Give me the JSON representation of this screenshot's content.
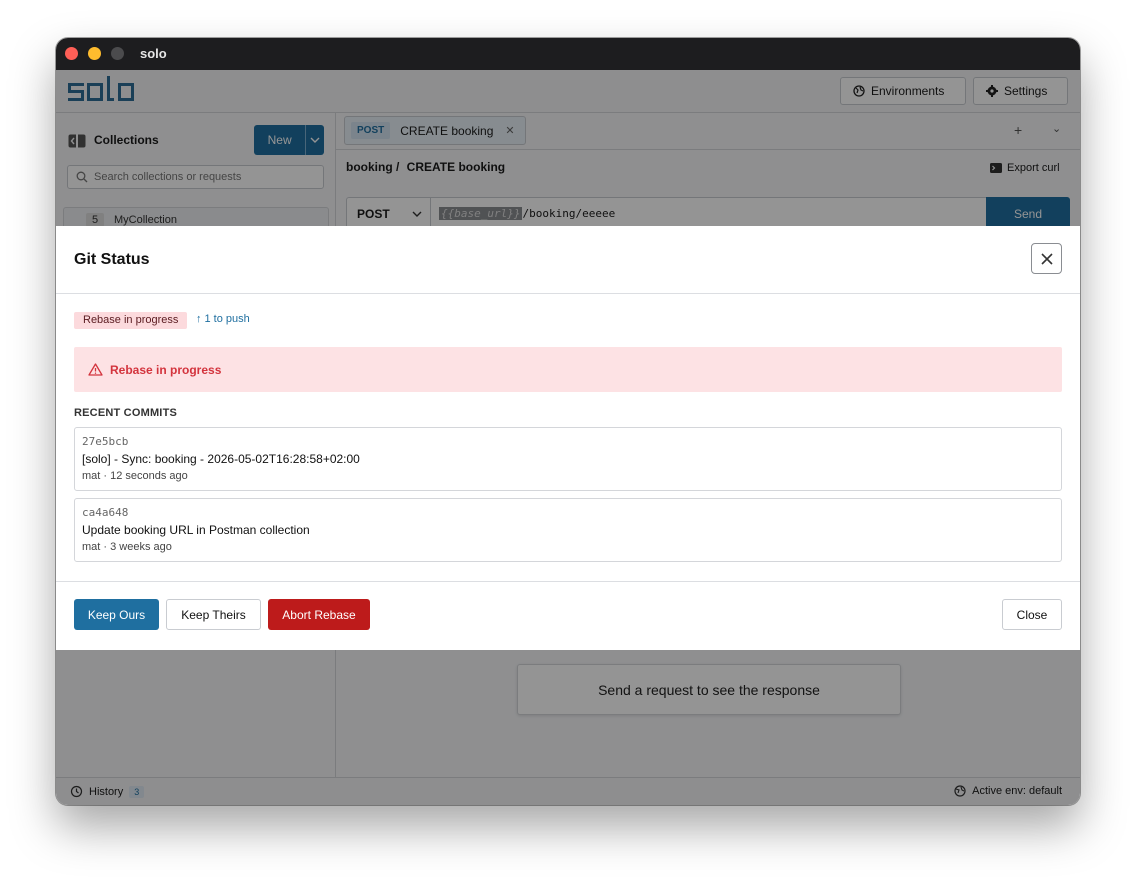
{
  "window": {
    "title": "solo"
  },
  "app": {
    "logo_text": "solo"
  },
  "header": {
    "environments_label": "Environments",
    "settings_label": "Settings"
  },
  "sidebar": {
    "title": "Collections",
    "new_label": "New",
    "search_placeholder": "Search collections or requests",
    "collections": [
      {
        "count": "5",
        "name": "MyCollection"
      }
    ]
  },
  "tabs": [
    {
      "method": "POST",
      "title": "CREATE booking"
    }
  ],
  "request": {
    "breadcrumb_parent": "booking /",
    "breadcrumb_title": "CREATE booking",
    "export_label": "Export curl",
    "method": "POST",
    "url_variable": "{{base_url}}",
    "url_path": "/booking/eeeee",
    "send_label": "Send"
  },
  "response": {
    "placeholder": "Send a request to see the response"
  },
  "statusbar": {
    "history_label": "History",
    "history_count": "3",
    "active_env": "Active env: default"
  },
  "modal": {
    "title": "Git Status",
    "status_badge": "Rebase in progress",
    "push_info": "1 to push",
    "alert_text": "Rebase in progress",
    "recent_commits_label": "RECENT COMMITS",
    "commits": [
      {
        "hash": "27e5bcb",
        "message": "[solo] - Sync: booking - 2026-05-02T16:28:58+02:00",
        "meta": "mat · 12 seconds ago"
      },
      {
        "hash": "ca4a648",
        "message": "Update booking URL in Postman collection",
        "meta": "mat · 3 weeks ago"
      }
    ],
    "buttons": {
      "keep_ours": "Keep Ours",
      "keep_theirs": "Keep Theirs",
      "abort_rebase": "Abort Rebase",
      "close": "Close"
    }
  },
  "colors": {
    "accent": "#1f6fa0",
    "danger": "#bd1b1b",
    "alert_bg": "#fde2e4",
    "alert_text": "#d3343d"
  }
}
